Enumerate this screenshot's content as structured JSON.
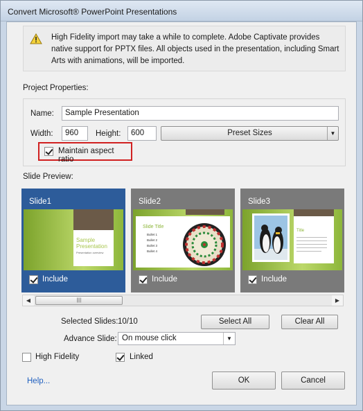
{
  "window": {
    "title": "Convert Microsoft® PowerPoint Presentations"
  },
  "warning": {
    "icon": "warning-icon",
    "text": "High Fidelity import may take a while to complete. Adobe Captivate provides native support for PPTX files. All objects used in the presentation, including Smart Arts with animations, will be imported."
  },
  "project": {
    "section_label": "Project Properties:",
    "name_label": "Name:",
    "name_value": "Sample Presentation",
    "width_label": "Width:",
    "width_value": "960",
    "height_label": "Height:",
    "height_value": "600",
    "preset_label": "Preset Sizes",
    "aspect_label": "Maintain aspect ratio",
    "aspect_checked": true
  },
  "preview": {
    "section_label": "Slide Preview:",
    "slides": [
      {
        "name": "Slide1",
        "include_label": "Include",
        "included": true,
        "selected": true,
        "thumb_title": "Sample Presentation",
        "thumb_sub": "Presentation overview"
      },
      {
        "name": "Slide2",
        "include_label": "Include",
        "included": true,
        "selected": false,
        "thumb_title": "Slide Title",
        "bullets": [
          "Bullet 1",
          "Bullet 2",
          "Bullet 3",
          "Bullet 4"
        ]
      },
      {
        "name": "Slide3",
        "include_label": "Include",
        "included": true,
        "selected": false,
        "thumb_title": "Title"
      }
    ]
  },
  "selection": {
    "selected_label": "Selected Slides:",
    "selected_value": "10/10",
    "select_all": "Select All",
    "clear_all": "Clear All",
    "advance_label": "Advance Slide:",
    "advance_value": "On mouse click"
  },
  "options": {
    "high_fidelity_label": "High Fidelity",
    "high_fidelity_checked": false,
    "linked_label": "Linked",
    "linked_checked": true
  },
  "footer": {
    "help": "Help...",
    "ok": "OK",
    "cancel": "Cancel"
  },
  "colors": {
    "selected_slide": "#2d5c9a",
    "unselected_slide": "#7a7a7a",
    "highlight": "#d02020",
    "link": "#1f5fbf"
  }
}
